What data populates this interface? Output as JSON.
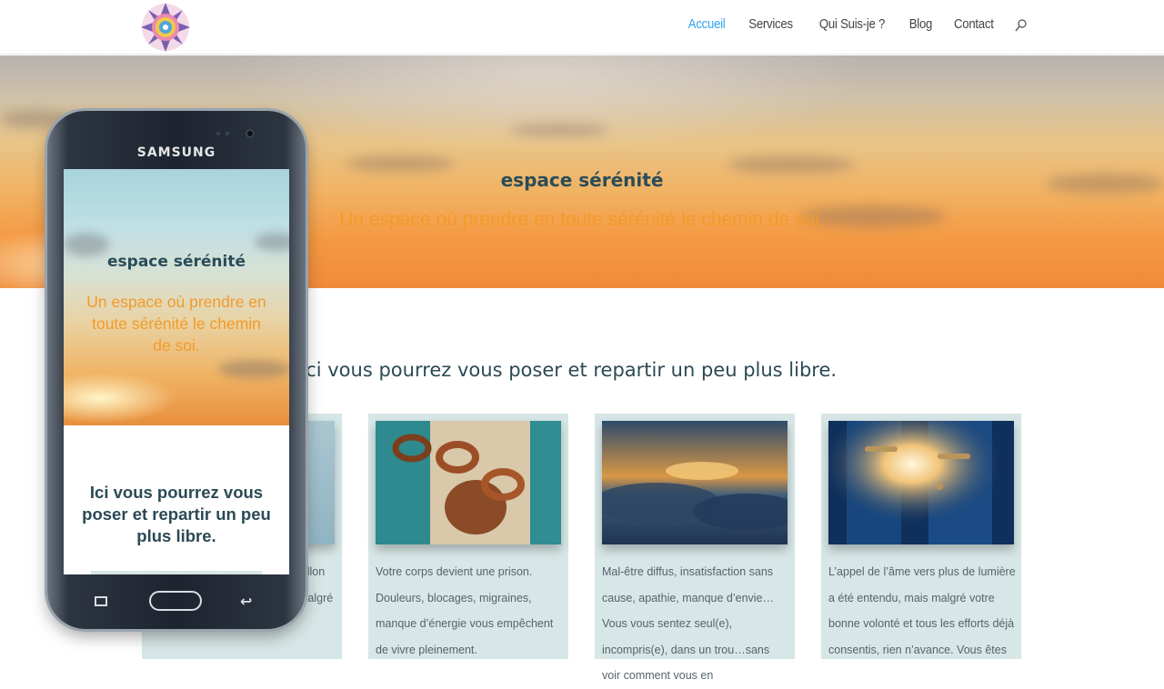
{
  "header": {
    "nav": [
      "Accueil",
      "Services",
      "Qui Suis-je ?",
      "Blog",
      "Contact"
    ],
    "active_index": 0
  },
  "hero": {
    "title": "espace sérénité",
    "subtitle": "Un espace où prendre en toute sérénité le chemin de soi."
  },
  "main": {
    "heading": "Ici vous pourrez vous poser et repartir un peu plus libre.",
    "cards": [
      {
        "visible_text": "billon\nmalgré"
      },
      {
        "text": "Votre corps devient une prison. Douleurs, blocages, migraines, manque d’énergie vous empêchent de vivre pleinement."
      },
      {
        "text": "Mal-être diffus, insatisfaction sans cause,  apathie, manque d’envie… Vous vous sentez seul(e), incompris(e), dans un trou…sans voir comment vous en"
      },
      {
        "text": "L’appel de l’âme vers plus de lumière a été entendu, mais malgré votre bonne volonté et tous les efforts déjà consentis, rien n’avance. Vous êtes"
      }
    ]
  },
  "phone": {
    "brand": "SAMSUNG",
    "screen_title": "espace sérénité",
    "screen_subtitle": "Un espace où prendre en toute sérénité le chemin de soi.",
    "screen_heading": "Ici vous pourrez vous poser et repartir un peu plus libre."
  },
  "colors": {
    "accent": "#2ea3f2",
    "heading": "#2b4a55",
    "orange": "#f39a2a",
    "card_bg": "#d7e6e6"
  },
  "icons": [
    "mandala-logo",
    "search-icon"
  ]
}
